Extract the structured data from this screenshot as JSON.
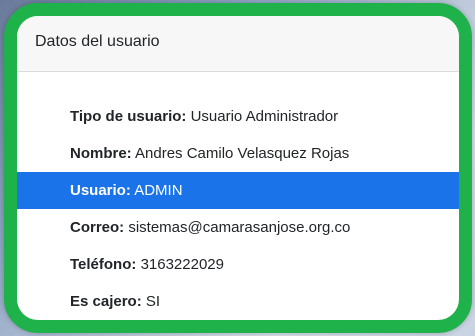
{
  "card": {
    "title": "Datos del usuario",
    "accent_border": "#1fb24a",
    "selection_color": "#1a73e8",
    "fields": [
      {
        "label": "Tipo de usuario:",
        "value": "Usuario Administrador"
      },
      {
        "label": "Nombre:",
        "value": "Andres Camilo Velasquez Rojas"
      },
      {
        "label": "Usuario:",
        "value": "ADMIN"
      },
      {
        "label": "Correo:",
        "value": "sistemas@camarasanjose.org.co"
      },
      {
        "label": "Teléfono:",
        "value": "3163222029"
      },
      {
        "label": "Es cajero:",
        "value": "SI"
      }
    ]
  }
}
